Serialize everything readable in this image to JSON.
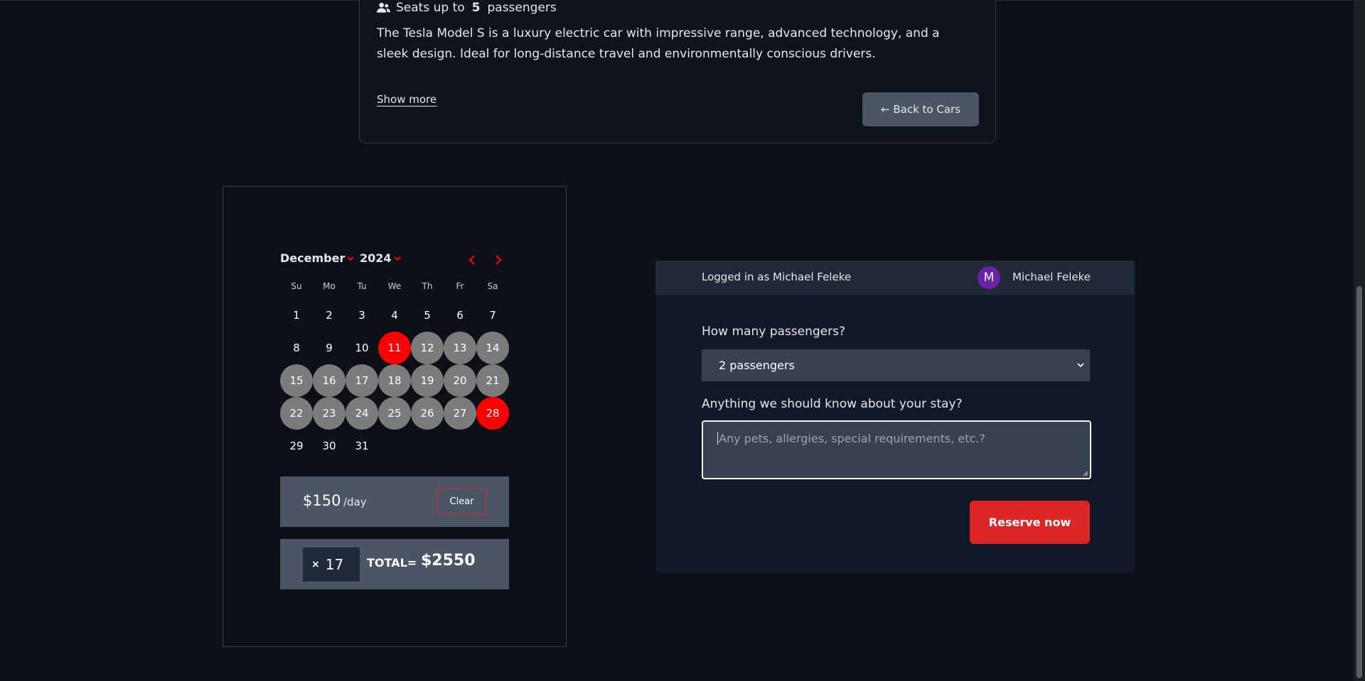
{
  "car": {
    "seats_prefix": "Seats up to",
    "seats_count": "5",
    "seats_suffix": "passengers",
    "description": "The Tesla Model S is a luxury electric car with impressive range, advanced technology, and a sleek design. Ideal for long-distance travel and environmentally conscious drivers.",
    "show_more": "Show more",
    "back_button": "← Back to Cars"
  },
  "calendar": {
    "month": "December",
    "year": "2024",
    "weekdays": [
      "Su",
      "Mo",
      "Tu",
      "We",
      "Th",
      "Fr",
      "Sa"
    ],
    "days": [
      "1",
      "2",
      "3",
      "4",
      "5",
      "6",
      "7",
      "8",
      "9",
      "10",
      "11",
      "12",
      "13",
      "14",
      "15",
      "16",
      "17",
      "18",
      "19",
      "20",
      "21",
      "22",
      "23",
      "24",
      "25",
      "26",
      "27",
      "28",
      "29",
      "30",
      "31"
    ],
    "range_start": 11,
    "range_end": 28,
    "accent_color": "#ff0000",
    "range_color": "#7b7b7b"
  },
  "pricing": {
    "price": "$150",
    "per_day": "/day",
    "clear_button": "Clear",
    "multiplier": "×",
    "days": "17",
    "total_label": "TOTAL=",
    "total_value": "$2550"
  },
  "reservation": {
    "logged_in_text": "Logged in as Michael Feleke",
    "avatar_initial": "M",
    "user_name": "Michael Feleke",
    "passengers_label": "How many passengers?",
    "passengers_value": "2 passengers",
    "notes_label": "Anything we should know about your stay?",
    "notes_placeholder": "Any pets, allergies, special requirements, etc.?",
    "reserve_button": "Reserve now",
    "reserve_color": "#dc2626",
    "avatar_color": "#6b21a8"
  }
}
